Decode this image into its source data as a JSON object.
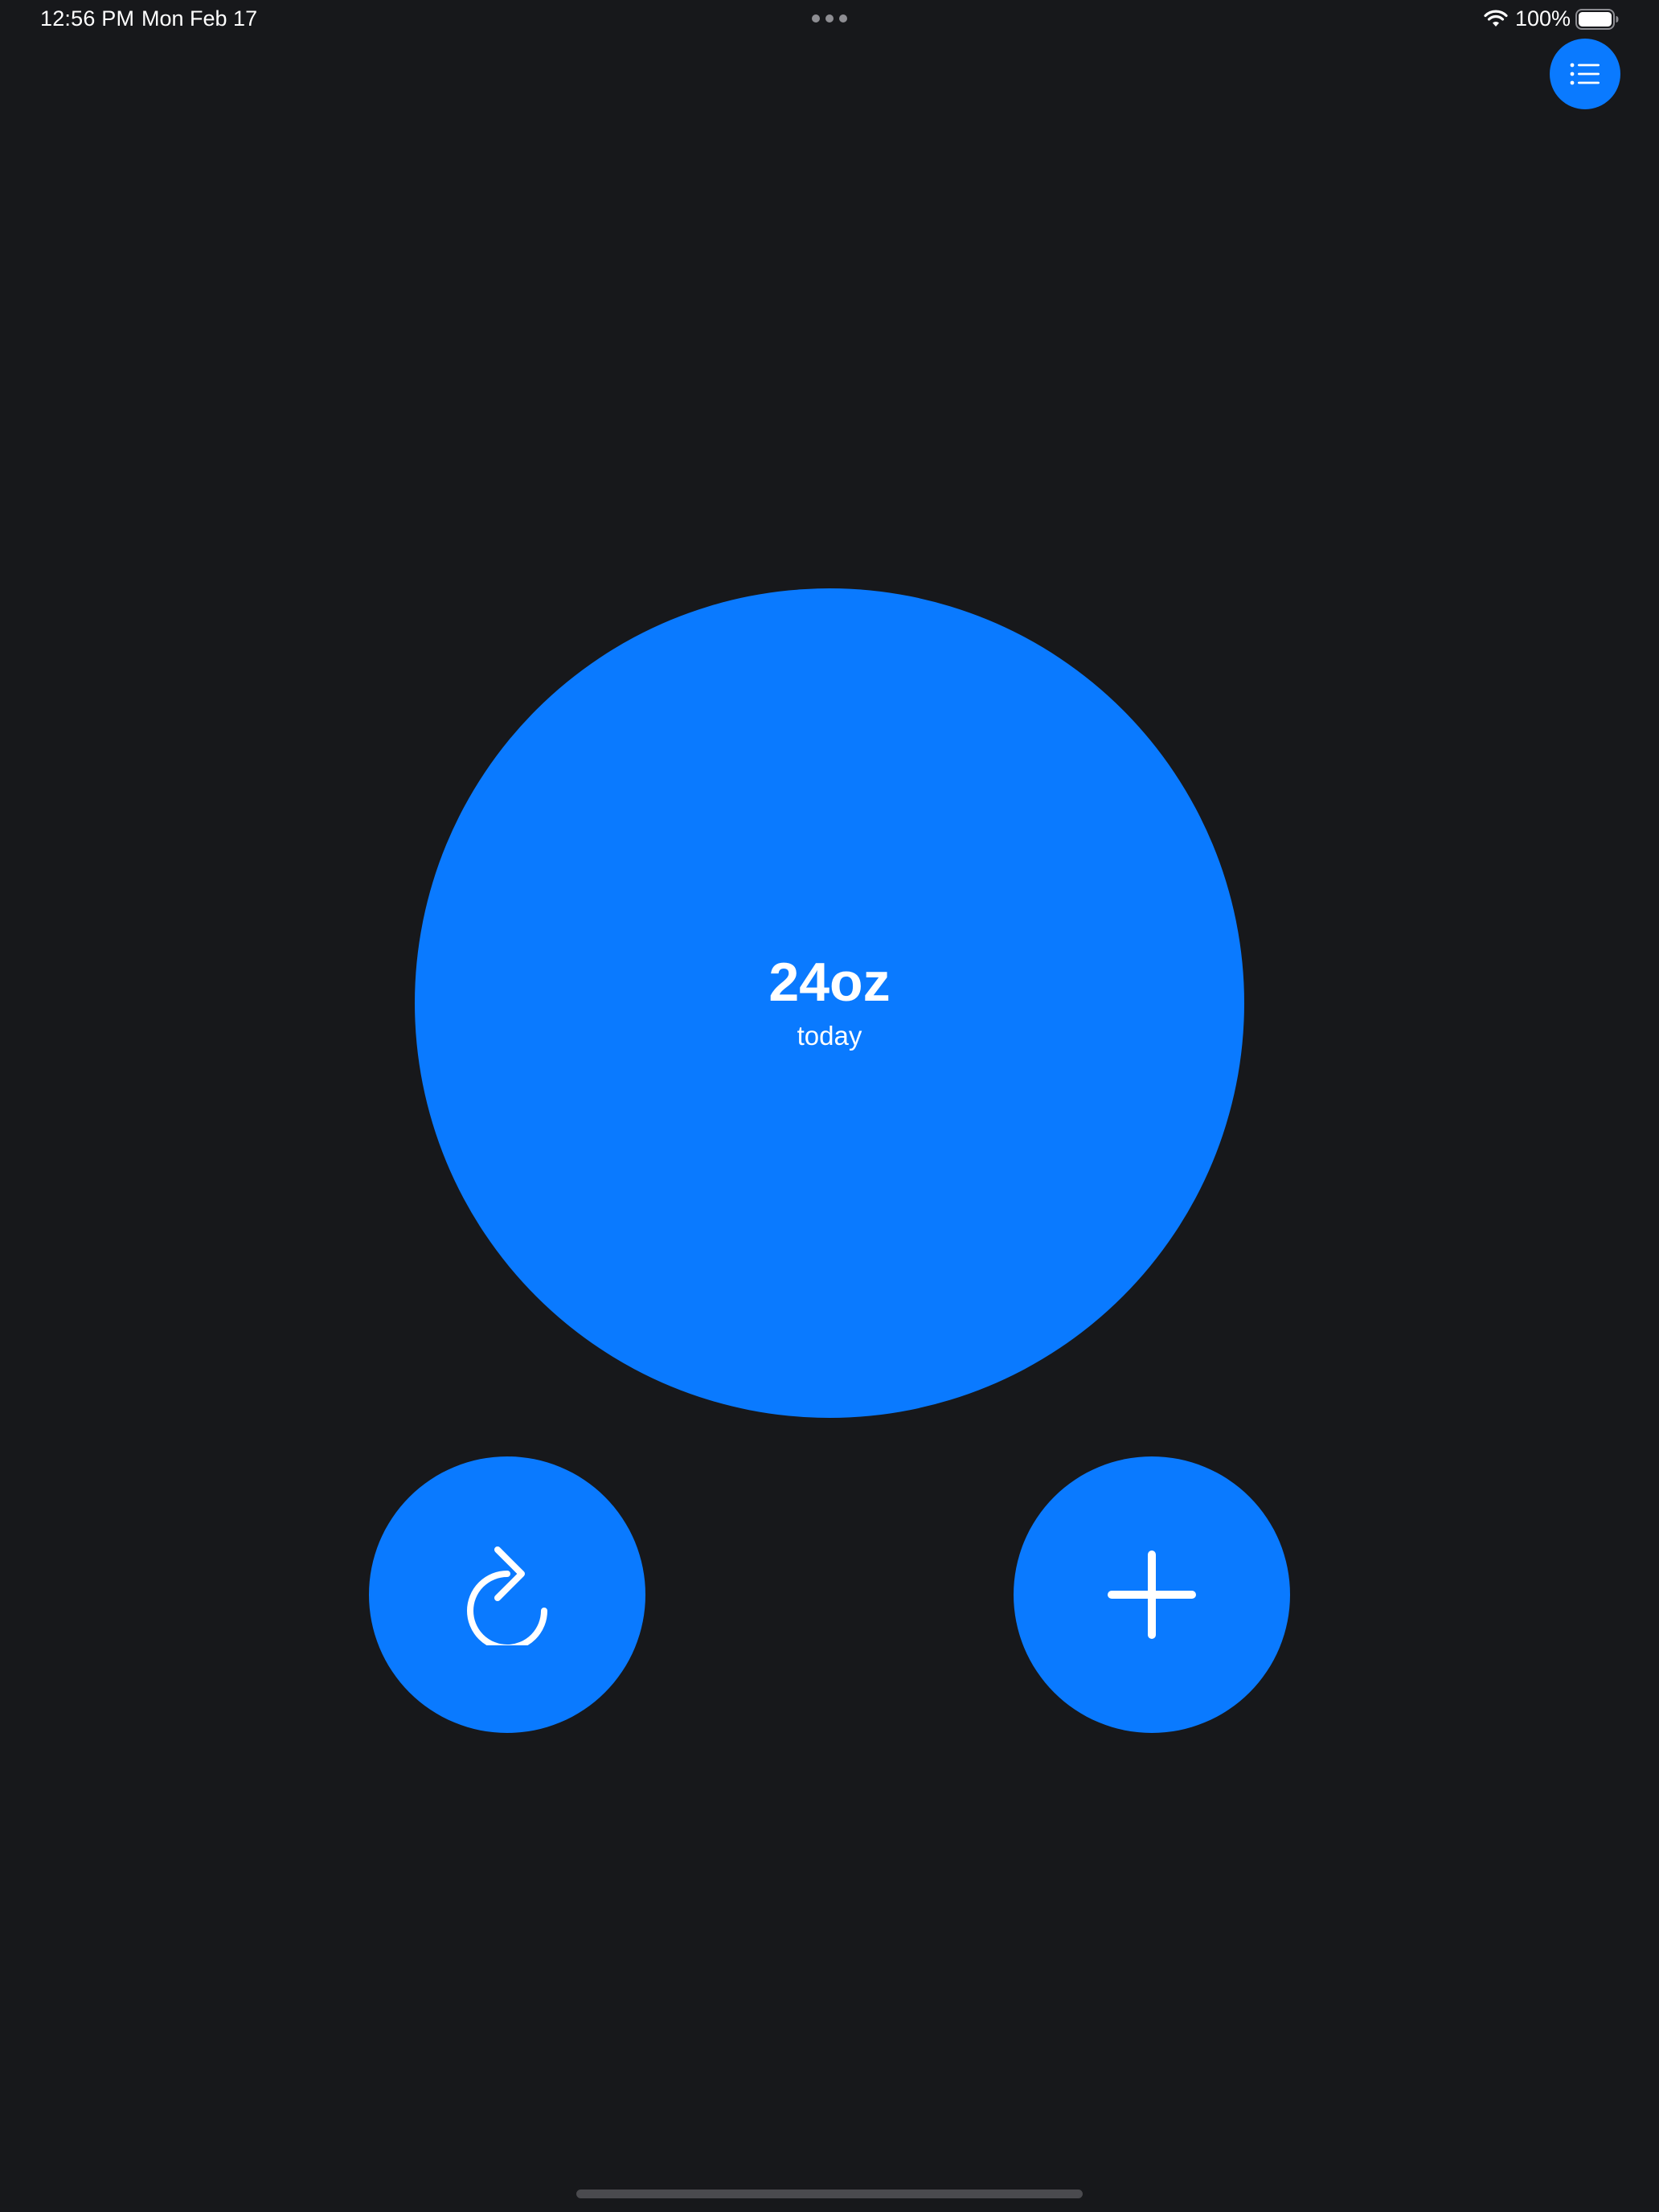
{
  "status_bar": {
    "time": "12:56 PM",
    "date": "Mon Feb 17",
    "battery_percent": "100%",
    "icons": [
      "wifi-icon",
      "battery-icon"
    ]
  },
  "header": {
    "list_button_icon": "list-icon"
  },
  "main": {
    "amount": "24oz",
    "caption": "today"
  },
  "actions": {
    "reset_icon": "reset-icon",
    "add_icon": "plus-icon"
  },
  "colors": {
    "accent": "#0a7aff",
    "background": "#17181b",
    "foreground": "#ffffff"
  }
}
